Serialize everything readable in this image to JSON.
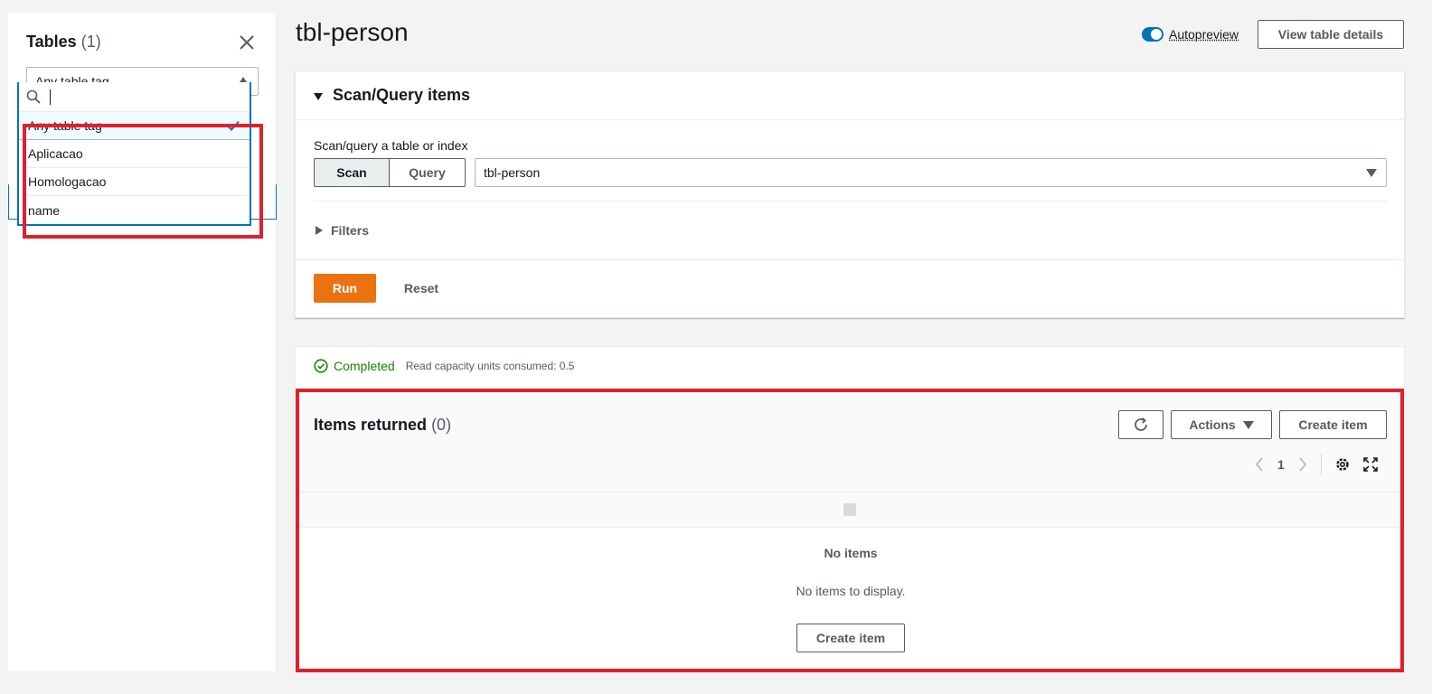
{
  "left_panel": {
    "title": "Tables",
    "count": "(1)",
    "tag_select": "Any table tag",
    "search_placeholder": "",
    "options": [
      "Any table tag",
      "Aplicacao",
      "Homologacao",
      "name"
    ]
  },
  "header": {
    "title": "tbl-person",
    "autopreview": "Autopreview",
    "view_details": "View table details"
  },
  "scan_panel": {
    "title": "Scan/Query items",
    "label": "Scan/query a table or index",
    "scan": "Scan",
    "query": "Query",
    "table_value": "tbl-person",
    "filters": "Filters",
    "run": "Run",
    "reset": "Reset"
  },
  "results": {
    "status": "Completed",
    "rcu": "Read capacity units consumed: 0.5",
    "title": "Items returned",
    "count": "(0)",
    "actions": "Actions",
    "create_item": "Create item",
    "page": "1",
    "no_items": "No items",
    "no_items_sub": "No items to display.",
    "create_item_mid": "Create item"
  },
  "colors": {
    "accent": "#0073bb",
    "run": "#ec7211",
    "success": "#1d8102",
    "highlight": "#e0202d"
  }
}
